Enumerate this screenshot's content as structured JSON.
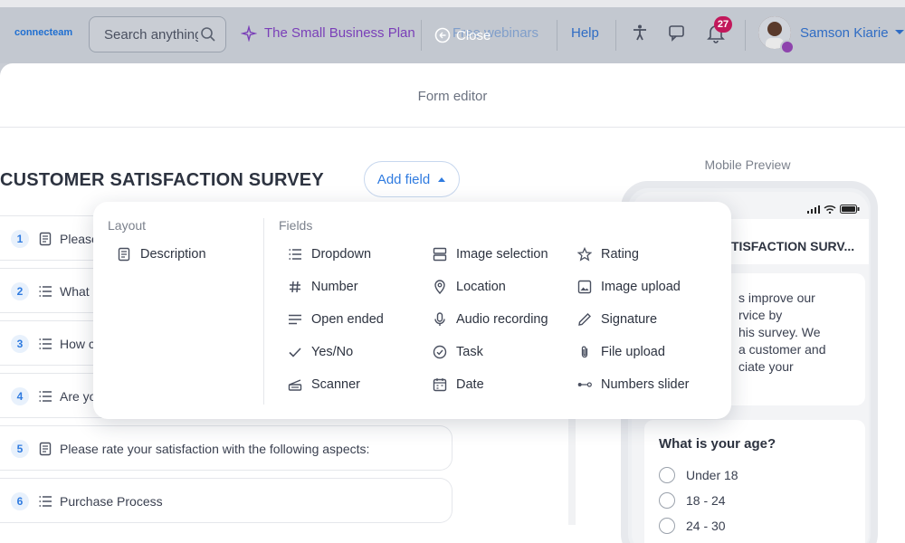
{
  "app": {
    "logo": "connecteam",
    "search_placeholder": "Search anything",
    "plan_link": "The Small Business Plan",
    "webinars_link": "Free webinars",
    "close_label": "Close",
    "help_link": "Help",
    "notifications_count": "27",
    "user_name": "Samson Kiarie"
  },
  "editor": {
    "panel_title": "Form editor",
    "survey_title": "CUSTOMER SATISFACTION SURVEY",
    "add_field_label": "Add field",
    "questions": [
      {
        "num": "1",
        "text": "Please",
        "icon": "description-icon"
      },
      {
        "num": "2",
        "text": "What",
        "icon": "list-icon"
      },
      {
        "num": "3",
        "text": "How c",
        "icon": "list-icon"
      },
      {
        "num": "4",
        "text": "Are yo",
        "icon": "list-icon"
      },
      {
        "num": "5",
        "text": "Please rate your satisfaction with the following aspects:",
        "icon": "description-icon"
      },
      {
        "num": "6",
        "text": "Purchase Process",
        "icon": "list-icon"
      }
    ]
  },
  "popover": {
    "layout_heading": "Layout",
    "fields_heading": "Fields",
    "layout_items": [
      "Description"
    ],
    "fields_col1": [
      "Dropdown",
      "Number",
      "Open ended",
      "Yes/No",
      "Scanner"
    ],
    "fields_col2": [
      "Image selection",
      "Location",
      "Audio recording",
      "Task",
      "Date"
    ],
    "fields_col3": [
      "Rating",
      "Image upload",
      "Signature",
      "File upload",
      "Numbers slider"
    ]
  },
  "preview": {
    "label": "Mobile Preview",
    "title": "TISFACTION SURV...",
    "intro_lines": [
      "s improve our",
      "rvice by",
      "his survey. We",
      "a customer and",
      "ciate your"
    ],
    "age_question": "What is your age?",
    "age_options": [
      "Under 18",
      "18 - 24",
      "24 - 30"
    ]
  },
  "colors": {
    "accent": "#2f7be0",
    "brand_purple": "#7a3fb8",
    "badge": "#c2185b"
  }
}
